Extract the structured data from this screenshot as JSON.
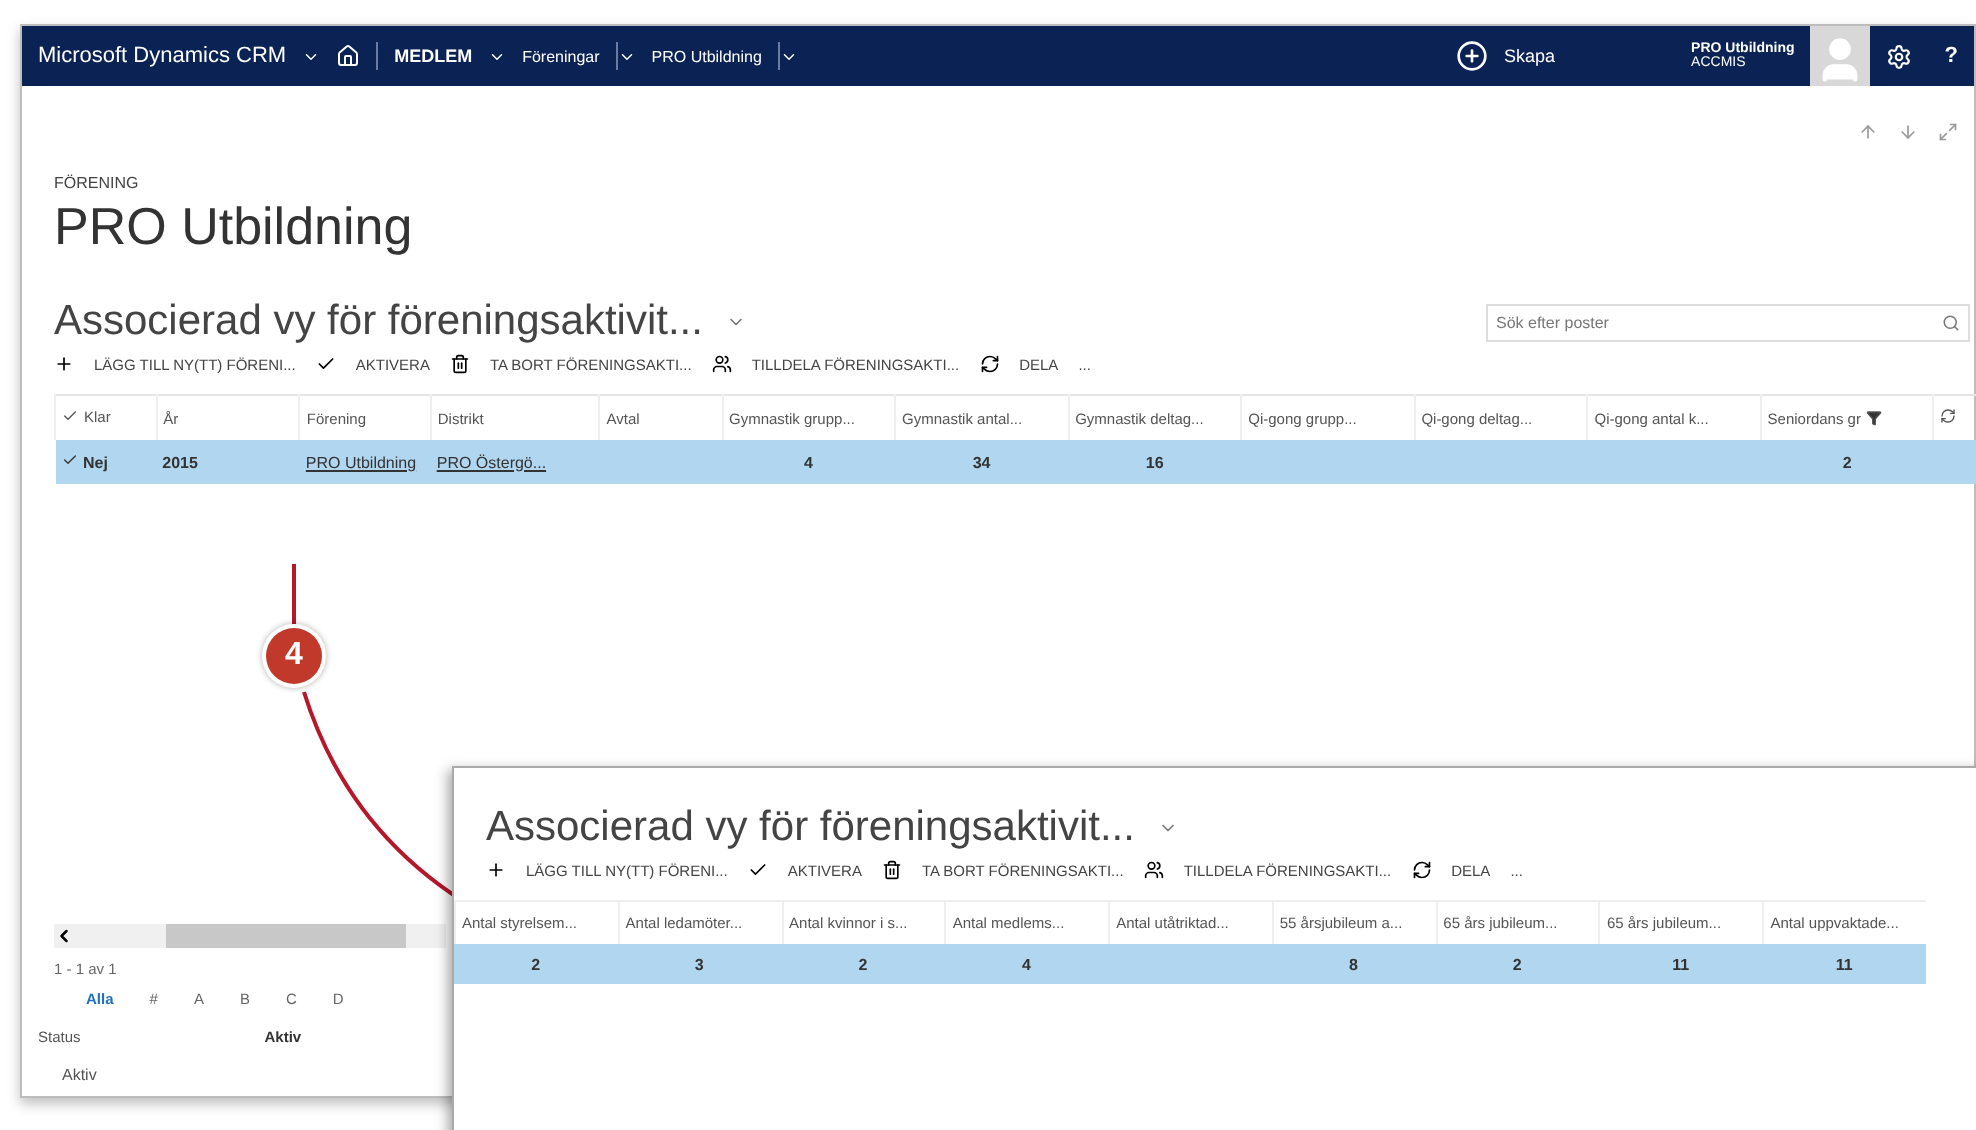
{
  "nav": {
    "brand": "Microsoft Dynamics CRM",
    "menus": [
      {
        "label": "MEDLEM",
        "kind": "area"
      },
      {
        "label": "Föreningar",
        "kind": "entity"
      },
      {
        "label": "PRO Utbildning",
        "kind": "entity"
      }
    ],
    "create": "Skapa",
    "user": {
      "name": "PRO Utbildning",
      "org": "ACCMIS"
    },
    "help": "?"
  },
  "record": {
    "type": "FÖRENING",
    "title": "PRO Utbildning"
  },
  "view": {
    "title": "Associerad vy för föreningsaktivit...",
    "search": {
      "placeholder": "Sök efter poster"
    },
    "commands": [
      {
        "kind": "add",
        "label": "LÄGG TILL NY(TT) FÖRENI..."
      },
      {
        "kind": "activate",
        "label": "AKTIVERA"
      },
      {
        "kind": "delete",
        "label": "TA BORT FÖRENINGSAKTI..."
      },
      {
        "kind": "assign",
        "label": "TILLDELA FÖRENINGSAKTI..."
      },
      {
        "kind": "share",
        "label": "DELA"
      },
      {
        "kind": "more",
        "label": "..."
      }
    ],
    "columns": [
      {
        "label": "Klar",
        "kind": "check"
      },
      {
        "label": "År"
      },
      {
        "label": "Förening"
      },
      {
        "label": "Distrikt"
      },
      {
        "label": "Avtal"
      },
      {
        "label": "Gymnastik grupp..."
      },
      {
        "label": "Gymnastik antal..."
      },
      {
        "label": "Gymnastik deltag..."
      },
      {
        "label": "Qi-gong grupp..."
      },
      {
        "label": "Qi-gong deltag..."
      },
      {
        "label": "Qi-gong antal k..."
      },
      {
        "label": "Seniordans gr",
        "kind": "filter"
      }
    ],
    "rows": [
      {
        "selected": true,
        "cells": [
          {
            "text": "Nej"
          },
          {
            "text": "2015"
          },
          {
            "text": "PRO Utbildning",
            "link": true
          },
          {
            "text": "PRO Östergö...",
            "link": true
          },
          {
            "text": ""
          },
          {
            "text": "4"
          },
          {
            "text": "34"
          },
          {
            "text": "16"
          },
          {
            "text": ""
          },
          {
            "text": ""
          },
          {
            "text": ""
          },
          {
            "text": "2"
          }
        ]
      }
    ],
    "pager": "1 - 1 av 1",
    "letters": [
      {
        "label": "Alla",
        "selected": true
      },
      {
        "label": "#",
        "selected": false
      },
      {
        "label": "A",
        "selected": false
      },
      {
        "label": "B",
        "selected": false
      },
      {
        "label": "C",
        "selected": false
      },
      {
        "label": "D",
        "selected": false
      }
    ],
    "status_label": "Status",
    "status_value": "Aktiv",
    "status_filter": "Aktiv"
  },
  "zoom": {
    "title": "Associerad vy för föreningsaktivit...",
    "commands": [
      {
        "kind": "add",
        "label": "LÄGG TILL NY(TT) FÖRENI..."
      },
      {
        "kind": "activate",
        "label": "AKTIVERA"
      },
      {
        "kind": "delete",
        "label": "TA BORT FÖRENINGSAKTI..."
      },
      {
        "kind": "assign",
        "label": "TILLDELA FÖRENINGSAKTI..."
      },
      {
        "kind": "share",
        "label": "DELA"
      },
      {
        "kind": "more",
        "label": "..."
      }
    ],
    "columns": [
      "Antal styrelsem...",
      "Antal ledamöter...",
      "Antal kvinnor i s...",
      "Antal medlems...",
      "Antal utåtriktad...",
      "55 årsjubileum a...",
      "65 års jubileum...",
      "65 års jubileum...",
      "Antal uppvaktade..."
    ],
    "rows": [
      {
        "selected": true,
        "cells": [
          "2",
          "3",
          "2",
          "4",
          "",
          "8",
          "2",
          "11",
          "11"
        ]
      }
    ]
  },
  "callout": {
    "number": "4"
  }
}
